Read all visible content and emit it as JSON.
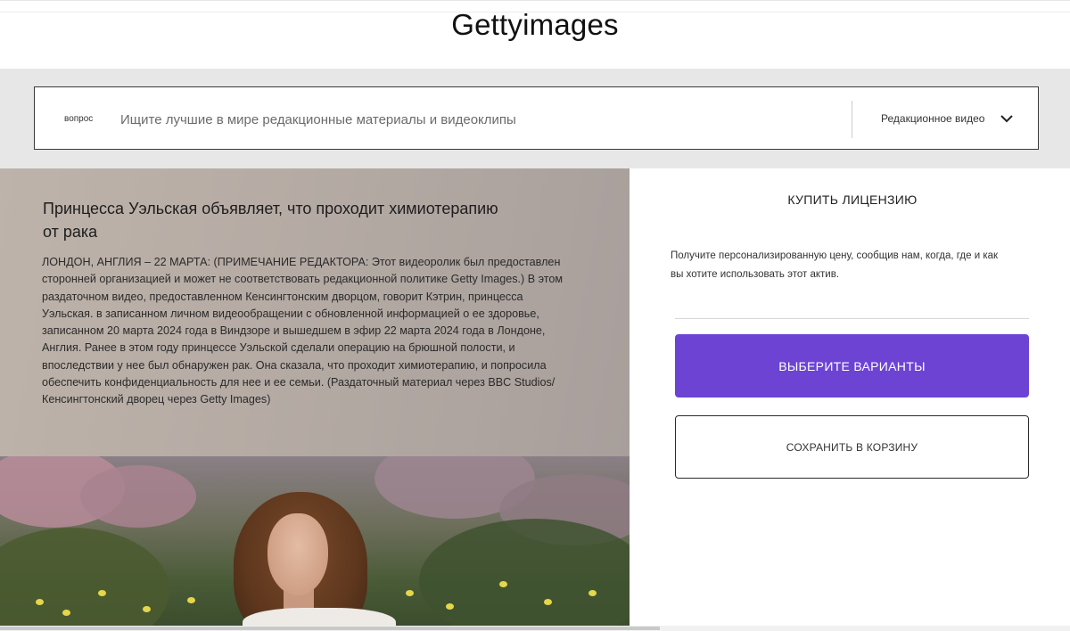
{
  "header": {
    "logo_text": "Gettyimages"
  },
  "search": {
    "prefix_label": "вопрос",
    "placeholder": "Ищите лучшие в мире редакционные материалы и видеоклипы",
    "value": "",
    "filter_label": "Редакционное видео"
  },
  "article": {
    "title": "Принцесса Уэльская объявляет, что проходит химиотерапию от рака",
    "body": "ЛОНДОН, АНГЛИЯ – 22 МАРТА: (ПРИМЕЧАНИЕ РЕДАКТОРА: Этот видеоролик был предоставлен сторонней организацией и может не соответствовать редакционной политике Getty Images.) В этом раздаточном видео, предоставленном Кенсингтонским дворцом, говорит Кэтрин, принцесса Уэльская. в записанном личном видеообращении с обновленной информацией о ее здоровье, записанном 20 марта 2024 года в Виндзоре и вышедшем в эфир 22 марта 2024 года в Лондоне, Англия. Ранее в этом году принцессе Уэльской сделали операцию на брюшной полости, и впоследствии у нее был обнаружен рак. Она сказала, что проходит химиотерапию, и попросила обеспечить конфиденциальность для нее и ее семьи. (Раздаточный материал через BBC Studios/Кенсингтонский дворец через Getty Images)"
  },
  "buy": {
    "title": "КУПИТЬ ЛИЦЕНЗИЮ",
    "description": "Получите персонализированную цену, сообщив нам, когда, где и как вы хотите использовать этот актив.",
    "primary_label": "ВЫБЕРИТЕ ВАРИАНТЫ",
    "secondary_label": "СОХРАНИТЬ В КОРЗИНУ"
  },
  "colors": {
    "accent": "#6d43d4",
    "search_band": "#e7e7e7",
    "article_bg": "#b5aba4"
  }
}
